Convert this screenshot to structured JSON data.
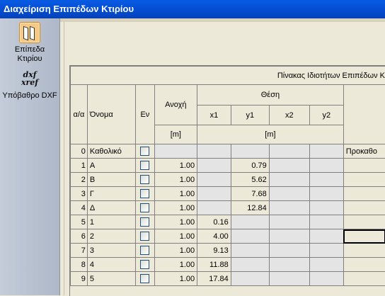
{
  "window": {
    "title": "Διαχείριση Επιπέδων Κτιρίου"
  },
  "sidebar": {
    "items": [
      {
        "label": "Επίπεδα Κτιρίου",
        "icon": "building-levels-icon"
      },
      {
        "label": "Υπόβαθρο DXF",
        "icon": "dxf-xref-icon",
        "icon_text": "dxf xref"
      }
    ]
  },
  "table": {
    "caption": "Πίνακας Ιδιοτήτων Επιπέδων Κ",
    "headers": {
      "aa": "α/α",
      "name": "Όνομα",
      "en": "Εν",
      "tolerance": "Ανοχή",
      "position": "Θέση",
      "x1": "x1",
      "y1": "y1",
      "x2": "x2",
      "y2": "y2",
      "unit_m": "[m]"
    },
    "rows": [
      {
        "aa": "0",
        "name": "Καθολικό",
        "anoxi": "",
        "x1": "",
        "y1": "",
        "x2": "",
        "y2": "",
        "extra": "Προκαθο"
      },
      {
        "aa": "1",
        "name": "Α",
        "anoxi": "1.00",
        "x1": "",
        "y1": "0.79",
        "x2": "",
        "y2": "",
        "extra": ""
      },
      {
        "aa": "2",
        "name": "Β",
        "anoxi": "1.00",
        "x1": "",
        "y1": "5.62",
        "x2": "",
        "y2": "",
        "extra": ""
      },
      {
        "aa": "3",
        "name": "Γ",
        "anoxi": "1.00",
        "x1": "",
        "y1": "7.68",
        "x2": "",
        "y2": "",
        "extra": ""
      },
      {
        "aa": "4",
        "name": "Δ",
        "anoxi": "1.00",
        "x1": "",
        "y1": "12.84",
        "x2": "",
        "y2": "",
        "extra": ""
      },
      {
        "aa": "5",
        "name": "1",
        "anoxi": "1.00",
        "x1": "0.16",
        "y1": "",
        "x2": "",
        "y2": "",
        "extra": ""
      },
      {
        "aa": "6",
        "name": "2",
        "anoxi": "1.00",
        "x1": "4.00",
        "y1": "",
        "x2": "",
        "y2": "",
        "extra": ""
      },
      {
        "aa": "7",
        "name": "3",
        "anoxi": "1.00",
        "x1": "9.13",
        "y1": "",
        "x2": "",
        "y2": "",
        "extra": ""
      },
      {
        "aa": "8",
        "name": "4",
        "anoxi": "1.00",
        "x1": "11.88",
        "y1": "",
        "x2": "",
        "y2": "",
        "extra": ""
      },
      {
        "aa": "9",
        "name": "5",
        "anoxi": "1.00",
        "x1": "17.84",
        "y1": "",
        "x2": "",
        "y2": "",
        "extra": ""
      }
    ]
  }
}
